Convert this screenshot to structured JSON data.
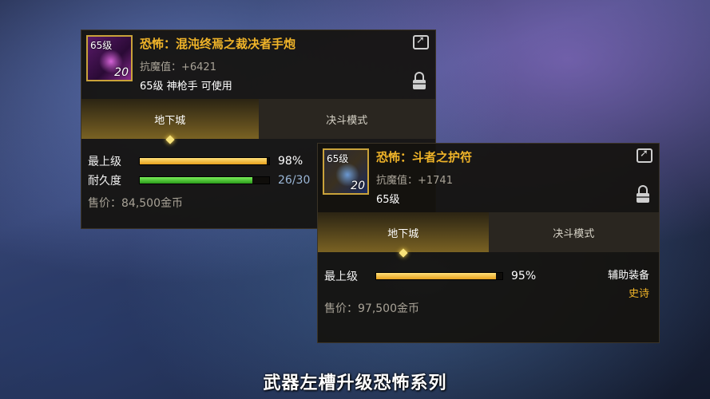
{
  "panel1": {
    "icon_level": "65级",
    "icon_number": "20",
    "title": "恐怖：混沌终焉之裁决者手炮",
    "stat": "抗魔值：+6421",
    "requirement": "65级 神枪手 可使用",
    "tabs": [
      {
        "label": "地下城",
        "active": true
      },
      {
        "label": "决斗模式",
        "active": false
      }
    ],
    "rows": [
      {
        "label": "最上级",
        "value": "98%",
        "fill_percent": 98,
        "color": "#f0b429"
      },
      {
        "label": "耐久度",
        "value": "26/30",
        "fill_percent": 87,
        "color": "#4ccf2c"
      }
    ],
    "price": "售价：84,500金币"
  },
  "panel2": {
    "icon_level": "65级",
    "icon_number": "20",
    "title": "恐怖：斗者之护符",
    "stat": "抗魔值：+1741",
    "requirement": "65级",
    "tabs": [
      {
        "label": "地下城",
        "active": true
      },
      {
        "label": "决斗模式",
        "active": false
      }
    ],
    "rows": [
      {
        "label": "最上级",
        "value": "95%",
        "fill_percent": 95,
        "color": "#f0b429"
      }
    ],
    "side_type": "辅助装备",
    "side_rarity": "史诗",
    "price": "售价：97,500金币"
  },
  "subtitle": "武器左槽升级恐怖系列",
  "icons": [
    "share-icon",
    "lock-icon"
  ]
}
